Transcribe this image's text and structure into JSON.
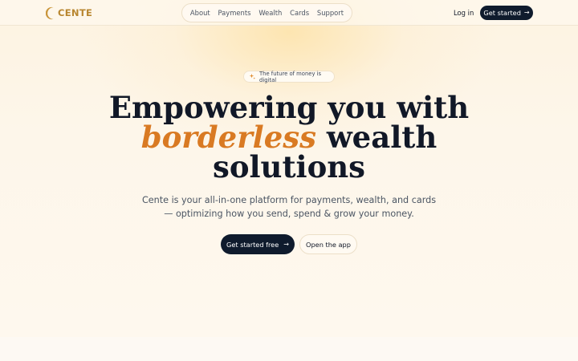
{
  "brand": {
    "name": "CENTE",
    "logo_icon": "crescent-c-logo",
    "color": "#b8862f"
  },
  "nav": {
    "items": [
      {
        "label": "About"
      },
      {
        "label": "Payments"
      },
      {
        "label": "Wealth"
      },
      {
        "label": "Cards"
      },
      {
        "label": "Support"
      }
    ]
  },
  "header": {
    "login_label": "Log in",
    "cta_label": "Get started",
    "cta_icon": "arrow-right-icon"
  },
  "hero": {
    "badge_icon": "sparkle-icon",
    "badge_text": "The future of money is digital",
    "headline_line1": "Empowering you with",
    "headline_accent": "borderless",
    "headline_line2_rest": " wealth",
    "headline_line3": "solutions",
    "subtitle_line1": "Cente is your all-in-one platform for payments, wealth, and cards",
    "subtitle_line2": "— optimizing how you send, spend & grow your money.",
    "primary_cta": "Get started free",
    "primary_cta_icon": "arrow-right-icon",
    "secondary_cta": "Open the app"
  },
  "colors": {
    "accent": "#d97a23",
    "dark_button": "#0f1b2d",
    "background": "#fdf7ec"
  }
}
